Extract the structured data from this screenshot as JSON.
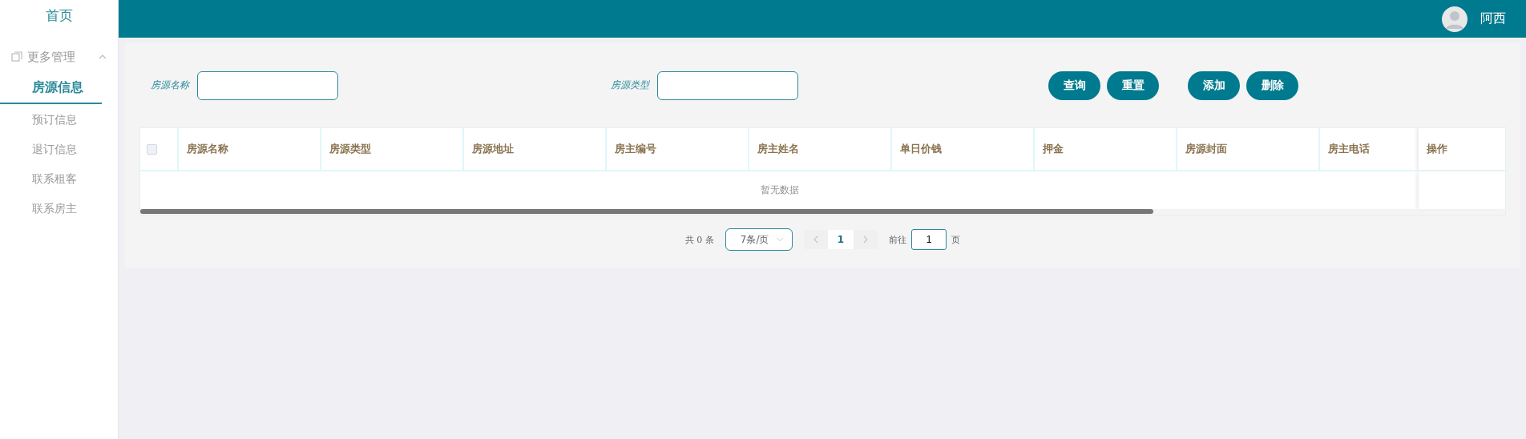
{
  "sidebar": {
    "home": "首页",
    "group": {
      "label": "更多管理",
      "expanded": true,
      "items": [
        {
          "label": "房源信息",
          "selected": true
        },
        {
          "label": "预订信息",
          "selected": false
        },
        {
          "label": "退订信息",
          "selected": false
        },
        {
          "label": "联系租客",
          "selected": false
        },
        {
          "label": "联系房主",
          "selected": false
        }
      ]
    }
  },
  "header": {
    "user": "阿西"
  },
  "filters": [
    {
      "label": "房源名称"
    },
    {
      "label": "房源类型"
    }
  ],
  "buttons": [
    {
      "label": "查询"
    },
    {
      "label": "重置"
    },
    {
      "label": "添加"
    },
    {
      "label": "删除"
    }
  ],
  "table": {
    "select_all": false,
    "columns": [
      "房源名称",
      "房源类型",
      "房源地址",
      "房主编号",
      "房主姓名",
      "单日价钱",
      "押金",
      "房源封面",
      "房主电话"
    ],
    "action_column": "操作",
    "empty_text": "暂无数据"
  },
  "pagination": {
    "total": "共 0 条",
    "page_size": "7条/页",
    "page": "1",
    "goto_label": "前往",
    "goto_value": "1",
    "goto_suffix": "页"
  }
}
